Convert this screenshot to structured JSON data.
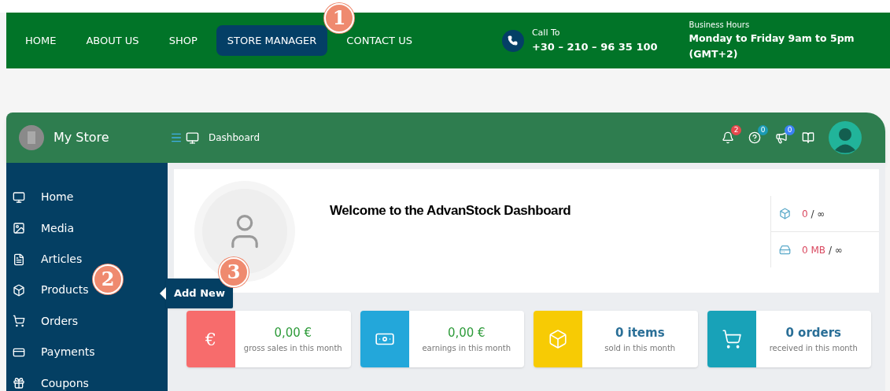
{
  "nav": [
    {
      "label": "HOME",
      "selected": false
    },
    {
      "label": "ABOUT US",
      "selected": false
    },
    {
      "label": "SHOP",
      "selected": false
    },
    {
      "label": "STORE MANAGER",
      "selected": true
    },
    {
      "label": "CONTACT US",
      "selected": false
    }
  ],
  "contact": {
    "label": "Call To",
    "phone": "+30 – 210 – 96 35 100"
  },
  "hours": {
    "label": "Business Hours",
    "lines": [
      "Monday to Friday 9am to 5pm",
      "(GMT+2)"
    ]
  },
  "store": {
    "name": "My Store",
    "breadcrumb": "Dashboard"
  },
  "header_icons": [
    {
      "kind": "bell",
      "badge": "2",
      "color": "#e5484d"
    },
    {
      "kind": "help",
      "badge": "0",
      "color": "#1b9bb5"
    },
    {
      "kind": "megaphone",
      "badge": "0",
      "color": "#3b82f6"
    },
    {
      "kind": "book"
    }
  ],
  "sidebar": {
    "items": [
      {
        "kind": "home",
        "label": "Home"
      },
      {
        "kind": "media",
        "label": "Media"
      },
      {
        "kind": "articles",
        "label": "Articles"
      },
      {
        "kind": "products",
        "label": "Products"
      },
      {
        "kind": "orders",
        "label": "Orders"
      },
      {
        "kind": "payments",
        "label": "Payments"
      },
      {
        "kind": "coupons",
        "label": "Coupons"
      }
    ]
  },
  "tooltip": "Add New",
  "welcome": "Welcome to the AdvanStock Dashboard",
  "limits": [
    {
      "kind": "products",
      "used": "0",
      "limit": "/ ∞"
    },
    {
      "kind": "storage",
      "used": "0 MB",
      "limit": "/ ∞"
    }
  ],
  "stats": [
    {
      "kind": "money",
      "symbol": "€",
      "color": "#f76c6c",
      "value": "0,00 €",
      "caption": "gross sales in this month"
    },
    {
      "kind": "money",
      "color": "#23a7da",
      "value": "0,00 €",
      "caption": "earnings in this month"
    },
    {
      "kind": "count",
      "color": "#f7cb04",
      "value": "0 items",
      "caption": "sold in this month"
    },
    {
      "kind": "count",
      "color": "#18a2b8",
      "value": "0 orders",
      "caption": "received in this month"
    }
  ],
  "callouts": [
    "1",
    "2",
    "3"
  ]
}
